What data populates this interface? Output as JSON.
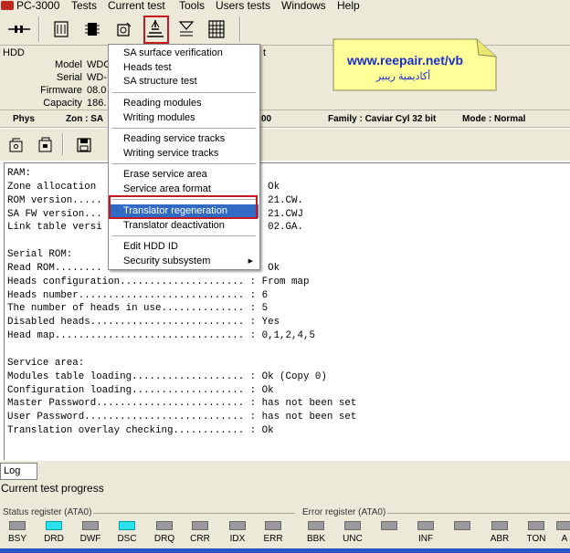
{
  "menubar": {
    "items": [
      "PC-3000",
      "Tests",
      "Current test",
      "Tools",
      "Users tests",
      "Windows",
      "Help"
    ]
  },
  "hdd": {
    "title": "HDD",
    "fields": [
      {
        "label": "Model",
        "value": "WDC"
      },
      {
        "label": "Serial",
        "value": "WD-"
      },
      {
        "label": "Firmware",
        "value": "08.0"
      },
      {
        "label": "Capacity",
        "value": "186."
      }
    ],
    "behind_menu_text": "t"
  },
  "infobar": {
    "phys": "Phys",
    "zon": "Zon : SA",
    "partial": "00",
    "family": "Family : Caviar Cyl 32 bit",
    "mode": "Mode : Normal"
  },
  "dropdown": {
    "items": [
      "SA surface verification",
      "Heads test",
      "SA structure test",
      "Reading modules",
      "Writing modules",
      "Reading service tracks",
      "Writing service tracks",
      "Erase service area",
      "Service area format",
      "Translator regeneration",
      "Translator deactivation",
      "Edit HDD ID",
      "Security subsystem"
    ],
    "highlighted": "Translator regeneration"
  },
  "note": {
    "url": "www.reepair.net/vb",
    "subtitle": "أكاديمية ريبير"
  },
  "log": {
    "lines": [
      "RAM:",
      "Zone allocation                           : Ok",
      "ROM version.....                          : 21.CW.",
      "SA FW version...                          : 21.CWJ",
      "Link table versi                          : 02.GA.",
      "",
      "Serial ROM:",
      "Read ROM........                          : Ok",
      "Heads configuration..................... : From map",
      "Heads number............................ : 6",
      "The number of heads in use.............. : 5",
      "Disabled heads.......................... : Yes",
      "Head map................................ : 0,1,2,4,5",
      "",
      "Service area:",
      "Modules table loading................... : Ok (Copy 0)",
      "Configuration loading................... : Ok",
      "Master Password......................... : has not been set",
      "User Password........................... : has not been set",
      "Translation overlay checking............ : Ok"
    ]
  },
  "lower": {
    "log_tab": "Log",
    "progress_label": "Current test progress",
    "status_group": "Status register (ATA0)",
    "error_group": "Error register (ATA0)",
    "status_leds": [
      {
        "label": "BSY",
        "on": false
      },
      {
        "label": "DRD",
        "on": true
      },
      {
        "label": "DWF",
        "on": false
      },
      {
        "label": "DSC",
        "on": true
      },
      {
        "label": "DRQ",
        "on": false
      },
      {
        "label": "CRR",
        "on": false
      },
      {
        "label": "IDX",
        "on": false
      },
      {
        "label": "ERR",
        "on": false
      }
    ],
    "error_leds": [
      {
        "label": "BBK",
        "on": false
      },
      {
        "label": "UNC",
        "on": false
      },
      {
        "label": "",
        "on": false
      },
      {
        "label": "INF",
        "on": false
      },
      {
        "label": "",
        "on": false
      },
      {
        "label": "ABR",
        "on": false
      },
      {
        "label": "TON",
        "on": false
      },
      {
        "label": "A",
        "on": false
      }
    ]
  },
  "colors": {
    "accent_highlight": "#316ac5",
    "led_on": "#29e3e8",
    "led_off": "#9a9a9a",
    "callout_frame": "#c3181f",
    "note_fill": "#ffff99",
    "note_text": "#1a2fc8"
  }
}
